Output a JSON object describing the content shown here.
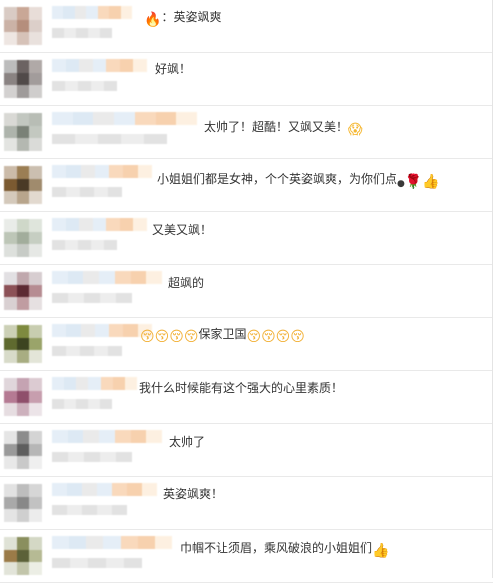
{
  "comments": [
    {
      "text": "：英姿飒爽",
      "emoji_before": [
        "fire-icon"
      ],
      "emoji_after": []
    },
    {
      "text": "好飒！",
      "emoji_before": [],
      "emoji_after": []
    },
    {
      "text": "太帅了！超酷！又飒又美！",
      "emoji_before": [],
      "emoji_after": [
        "shocked-face-icon"
      ]
    },
    {
      "text": "小姐姐们都是女神，个个英姿飒爽，为你们点",
      "emoji_before": [],
      "emoji_after": [
        "like-dot-icon",
        "rose-icon",
        "thumbs-up-icon"
      ]
    },
    {
      "text": "又美又飒！",
      "emoji_before": [],
      "emoji_after": []
    },
    {
      "text": "超飒的",
      "emoji_before": [],
      "emoji_after": []
    },
    {
      "text": "保家卫国",
      "emoji_before": [
        "kissing-face-icon",
        "kissing-face-icon",
        "kissing-face-icon",
        "kissing-face-icon"
      ],
      "emoji_after": [
        "kissing-face-icon",
        "kissing-face-icon",
        "kissing-face-icon",
        "kissing-face-icon"
      ]
    },
    {
      "text": "我什么时候能有这个强大的心里素质！",
      "emoji_before": [],
      "emoji_after": []
    },
    {
      "text": "太帅了",
      "emoji_before": [],
      "emoji_after": []
    },
    {
      "text": "英姿飒爽！",
      "emoji_before": [],
      "emoji_after": []
    },
    {
      "text": "巾帼不让须眉，乘风破浪的小姐姐们",
      "emoji_before": [],
      "emoji_after": [
        "thumbs-up-icon"
      ]
    }
  ],
  "colors": {
    "text": "#333333",
    "divider": "#e9e9e9",
    "blur_blue": "#cfe0f0",
    "blur_orange": "#f6c9a0",
    "blur_gray": "#e6e6e6"
  }
}
